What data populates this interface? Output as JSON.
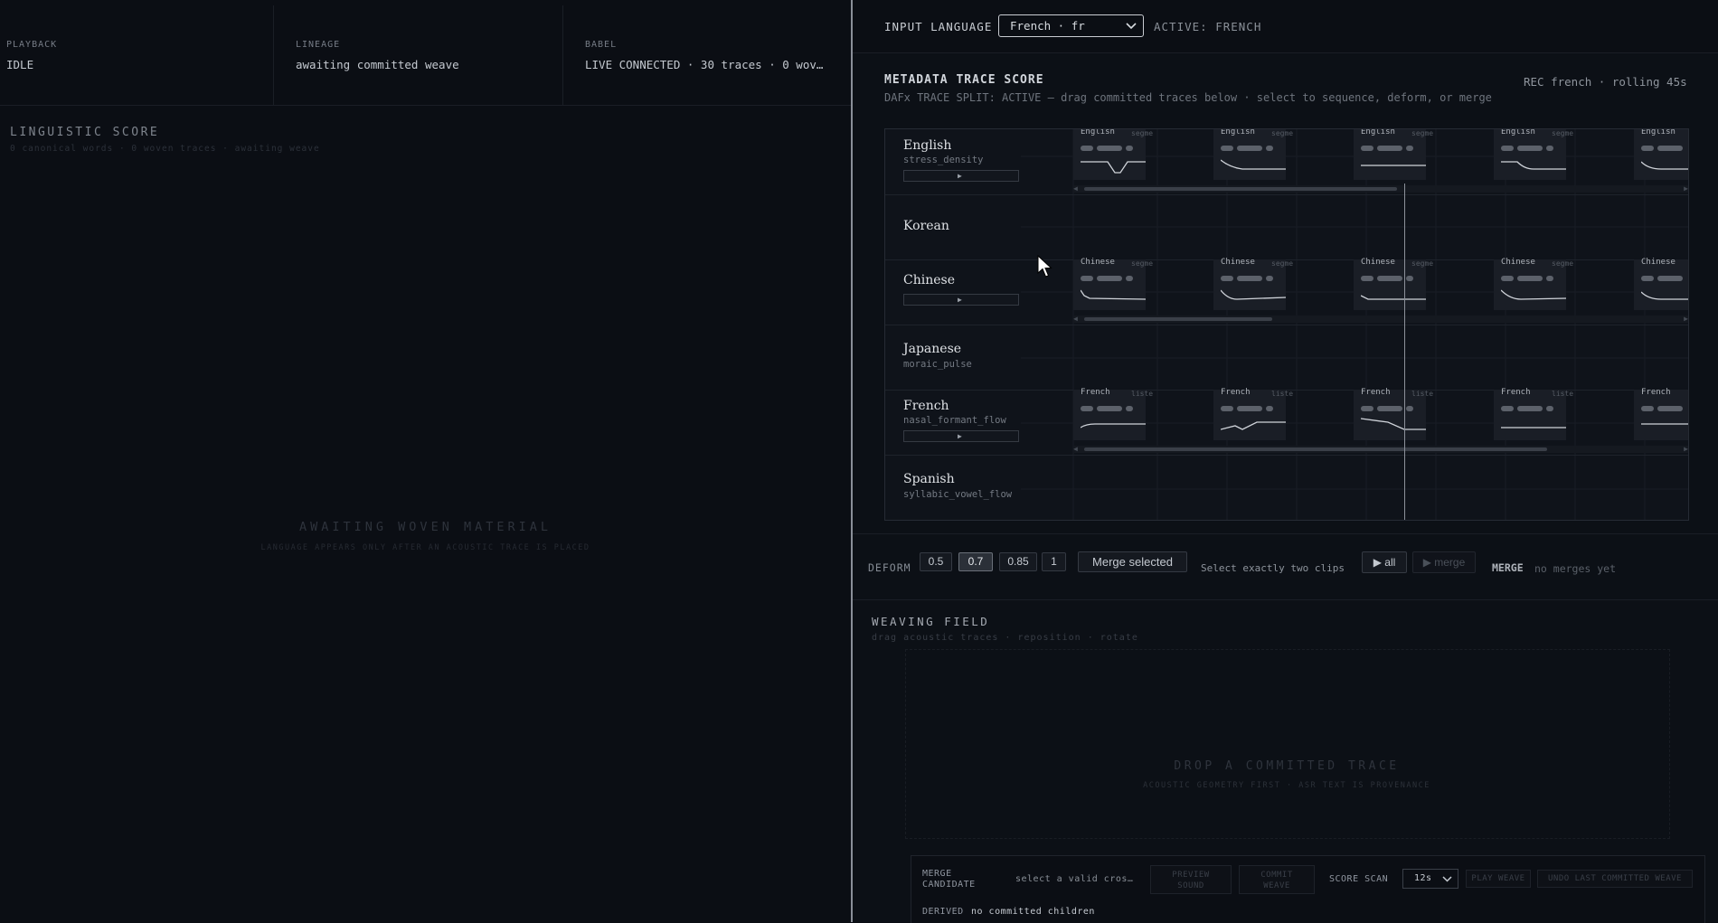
{
  "topbar": {
    "playback": {
      "label": "PLAYBACK",
      "value": "IDLE"
    },
    "lineage": {
      "label": "LINEAGE",
      "value": "awaiting committed weave"
    },
    "babel": {
      "label": "BABEL",
      "value": "LIVE CONNECTED · 30 traces · 0 wov…"
    }
  },
  "linguistic": {
    "title": "LINGUISTIC SCORE",
    "subtitle": "0 canonical words · 0 woven traces · awaiting weave",
    "await_title": "AWAITING WOVEN MATERIAL",
    "await_subtitle": "LANGUAGE APPEARS ONLY AFTER AN ACOUSTIC TRACE IS PLACED"
  },
  "input_language": {
    "label": "INPUT LANGUAGE",
    "selected": "French · fr",
    "active": "ACTIVE: FRENCH"
  },
  "metadata": {
    "title": "METADATA TRACE SCORE",
    "subtitle": "DAFx TRACE SPLIT: ACTIVE — drag committed traces below · select to sequence, deform, or merge",
    "rec": "REC french · rolling 45s"
  },
  "tracks": [
    {
      "name": "English",
      "metric": "stress_density",
      "clip_label": "English",
      "clip_tag": "segme"
    },
    {
      "name": "Korean",
      "metric": ""
    },
    {
      "name": "Chinese",
      "metric": "",
      "clip_label": "Chinese",
      "clip_tag": "segme"
    },
    {
      "name": "Japanese",
      "metric": "moraic_pulse"
    },
    {
      "name": "French",
      "metric": "nasal_formant_flow",
      "clip_label": "French",
      "clip_tag": "liste"
    },
    {
      "name": "Spanish",
      "metric": "syllabic_vowel_flow"
    }
  ],
  "deform": {
    "label": "DEFORM",
    "values": [
      "0.5",
      "0.7",
      "0.85",
      "1"
    ],
    "selected": "0.7",
    "merge_selected": "Merge selected",
    "hint": "Select exactly two clips",
    "play_all": "▶ all",
    "play_merge": "▶ merge",
    "merge_label": "MERGE",
    "merge_value": "no merges yet"
  },
  "weaving": {
    "title": "WEAVING FIELD",
    "subtitle": "drag acoustic traces · reposition · rotate",
    "drop_title": "DROP A COMMITTED TRACE",
    "drop_subtitle": "ACOUSTIC GEOMETRY FIRST · ASR TEXT IS PROVENANCE"
  },
  "footer": {
    "merge_candidate_line1": "MERGE",
    "merge_candidate_line2": "CANDIDATE",
    "merge_candidate_value": "select a valid cros…",
    "preview_line1": "PREVIEW",
    "preview_line2": "SOUND",
    "commit_line1": "COMMIT",
    "commit_line2": "WEAVE",
    "score_scan": "SCORE SCAN",
    "scan_value": "12s",
    "play_weave": "PLAY WEAVE",
    "undo": "UNDO LAST COMMITTED WEAVE",
    "derived_label": "DERIVED",
    "derived_value": "no committed children"
  },
  "colors": {
    "background": "#0a0d13",
    "panel": "#0c1016",
    "divider": "#8a8f98",
    "text": "#c4c9d0"
  }
}
